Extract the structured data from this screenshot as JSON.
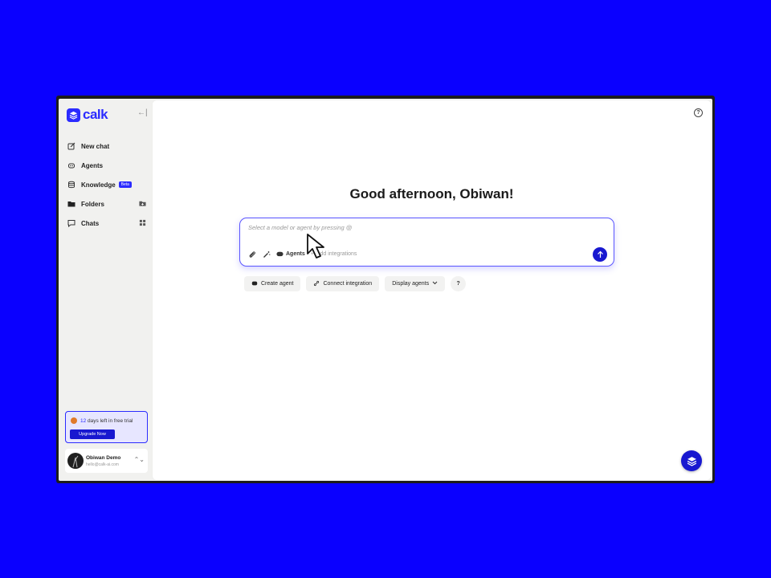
{
  "app": {
    "logo_text": "calk",
    "accent_color": "#2b2bff",
    "background_color": "#0a00ff"
  },
  "sidebar": {
    "items": [
      {
        "label": "New chat",
        "icon": "edit-icon"
      },
      {
        "label": "Agents",
        "icon": "agent-icon"
      },
      {
        "label": "Knowledge",
        "icon": "database-icon",
        "badge": "Beta"
      },
      {
        "label": "Folders",
        "icon": "folder-icon",
        "action_icon": "add-folder-icon"
      },
      {
        "label": "Chats",
        "icon": "chat-icon",
        "action_icon": "grid-icon"
      }
    ],
    "trial": {
      "days": "12",
      "text": " days left in free trial",
      "button": "Upgrade Now"
    },
    "user": {
      "name": "Obiwan Demo",
      "email": "hello@calk-ai.com"
    }
  },
  "main": {
    "greeting": "Good afternoon, Obiwan!",
    "composer": {
      "placeholder": "Select a model or agent by pressing @",
      "agents_label": "Agents",
      "integrations_label": "Add integrations"
    },
    "actions": {
      "create_agent": "Create agent",
      "connect_integration": "Connect integration",
      "display_agents": "Display agents",
      "help": "?"
    },
    "help_icon": "?"
  }
}
